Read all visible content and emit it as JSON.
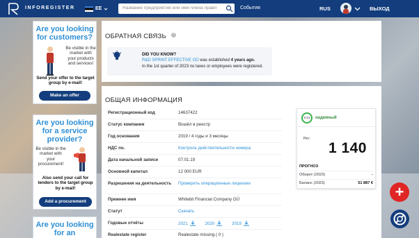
{
  "header": {
    "brand": "INFOREGISTER",
    "country_code": "EE",
    "search_placeholder": "Название предприятия или имя члена правл",
    "events_label": "События",
    "language": "RUS",
    "logout_label": "ВЫХОД"
  },
  "ads": [
    {
      "title": "Are you looking for customers?",
      "text": "Be visible in the market with your products and services!",
      "bold": "Send your offer to the target group by e-mail!",
      "button": "Make an offer"
    },
    {
      "title": "Are you looking for a service provider?",
      "text": "Be visible in the market with your procurement!",
      "bold": "Also send your call for tenders to the target group by e-mail!",
      "button": "Add a procurement"
    },
    {
      "title": "Are you looking for an"
    }
  ],
  "feedback": {
    "title": "ОБРАТНАЯ СВЯЗЬ",
    "did_you_know": "DID YOU KNOW?",
    "company_link": "R&D SPRINT EFFECTIVE OÜ",
    "established_text": " was established ",
    "established_years": "4 years ago.",
    "tax_text": "In the 1st quarter of 2023 no taxes or employees were registered."
  },
  "general": {
    "title": "ОБЩАЯ ИНФОРМАЦИЯ",
    "rows": [
      {
        "label": "Регистрационный код",
        "value": "14637422"
      },
      {
        "label": "Статус компании",
        "value": "Вошёл в реестр"
      },
      {
        "label": "Год основания",
        "value": "2019 / 4 годы и 3 месяцы"
      },
      {
        "label": "НДС no.",
        "value": "Контроль действительности номера"
      },
      {
        "label": "Дата начальной записи",
        "value": "07.01.19"
      },
      {
        "label": "Основной капитал",
        "value": "12 000 EUR"
      },
      {
        "label": "Разрешения на деятельность",
        "value": "Проверить операционные лицензии"
      },
      {
        "label": "Прежнее имя",
        "value": "Whitebit Financial Company OÜ"
      },
      {
        "label": "Статут",
        "value": "Скачать"
      },
      {
        "label": "Годовые отчёты",
        "years": [
          "2021",
          "2020",
          "2019"
        ]
      },
      {
        "label": "Realestate register",
        "value": "Realestate missing ( 0 )"
      }
    ]
  },
  "forecast": {
    "score": "0.01",
    "reliability": "надежный",
    "reg_label": "Рег:",
    "reg_value": "1 140",
    "prognosis_label": "ПРОГНОЗ",
    "turnover_label": "Оборот (2023)",
    "turnover_value": "-",
    "balance_label": "Баланс (2023)",
    "balance_value": "51 887 €"
  },
  "fab": {
    "plus": "+"
  },
  "colors": {
    "nav": "#133d7d",
    "accent": "#2d8fd6",
    "fab_red": "#e02525",
    "reliable_green": "#3ab34a"
  }
}
